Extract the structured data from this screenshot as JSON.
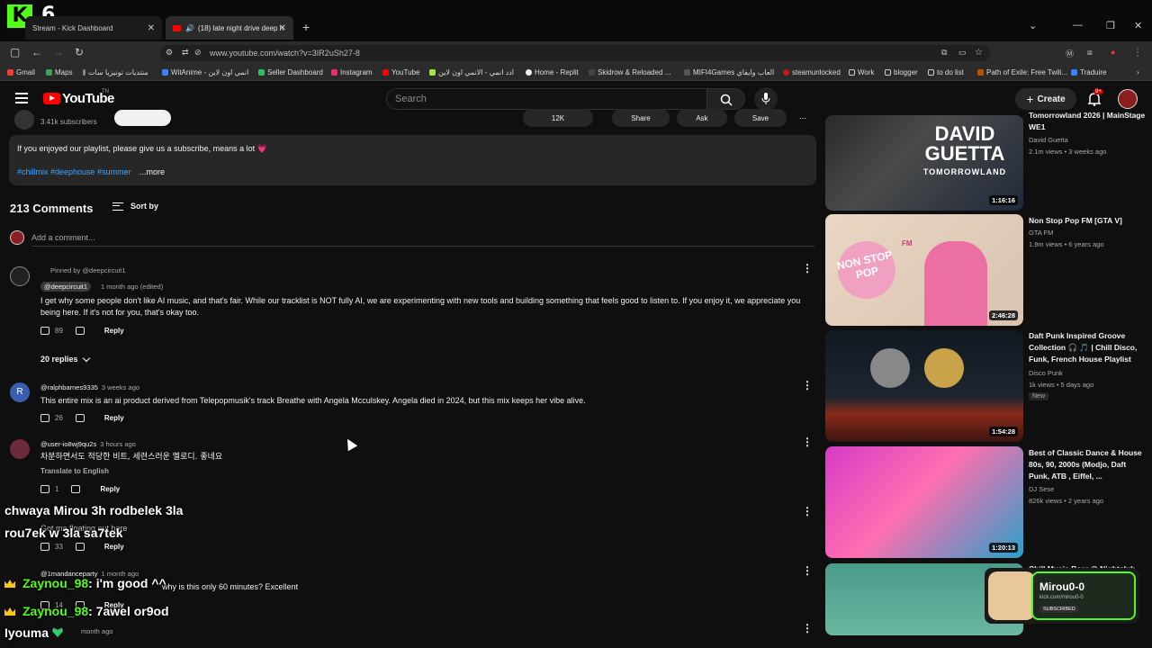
{
  "browser": {
    "tabs": [
      {
        "label": "Stream - Kick Dashboard"
      },
      {
        "label": "(18) late night drive deep h"
      }
    ],
    "url": "www.youtube.com/watch?v=3IR2uSh27-8",
    "bookmarks": [
      "Gmail",
      "Maps",
      "منتديات تونيزيا سات",
      "WitAnime - انمي اون لاين",
      "Seller Dashboard",
      "Instagram",
      "YouTube",
      "ادد انمي - الانمي اون لاين",
      "Home - Replit",
      "Skidrow & Reloaded ...",
      "MIFI4Games العاب وايفاي",
      "steamunlocked",
      "Work",
      "blogger",
      "to do list",
      "Path of Exile: Free Twili...",
      "Traduire"
    ]
  },
  "overlay": {
    "kick_logo": "K",
    "kick_number": "6",
    "chat": [
      {
        "user": "",
        "text": "chwaya Mirou 3h rodbelek 3la"
      },
      {
        "user": "",
        "text": "rou7ek w 3la sa7tek"
      },
      {
        "user": "Zaynou_98",
        "text": ": i'm good ^^"
      },
      {
        "user": "Zaynou_98",
        "text": ": 7awel or9od"
      },
      {
        "user": "Iyouma",
        "text": ""
      }
    ],
    "card": {
      "name": "Mirou0-0",
      "url": "kick.com/mirou0-0",
      "subscribed": "SUBSCRIBED"
    }
  },
  "header": {
    "logo_text": "YouTube",
    "logo_tn": "TN",
    "search_placeholder": "Search",
    "create_label": "Create",
    "notif_count": "9+"
  },
  "video": {
    "subscribers": "3.41k subscribers",
    "actions": [
      "12K",
      "",
      "Share",
      "Ask",
      "Save"
    ],
    "description": "If you enjoyed our playlist, please give us a subscribe, means a lot 💗",
    "hashtags": "#chillmix #deephouse #summer",
    "more": "...more"
  },
  "comments": {
    "count_label": "213 Comments",
    "sort_label": "Sort by",
    "add_placeholder": "Add a comment...",
    "items": [
      {
        "pinned": "Pinned by @deepcircuit1",
        "user": "@deepcircuit1",
        "time": "1 month ago (edited)",
        "text": "I get why some people don't like AI music, and that's fair. While our tracklist is NOT fully AI, we are experimenting with new tools and building something that feels good to listen to. If you enjoy it, we appreciate you being here. If it's not for you, that's okay too.",
        "likes": "89",
        "reply": "Reply",
        "replies": "20 replies"
      },
      {
        "user": "@ralphbarnes9335",
        "time": "3 weeks ago",
        "text": "This entire mix is an ai product derived from Telepopmusik's track Breathe with Angela Mcculskey. Angela died in 2024, but this mix keeps her vibe alive.",
        "likes": "26",
        "reply": "Reply"
      },
      {
        "user": "@user-io8wj9qu2s",
        "time": "3 hours ago",
        "text": "차분하면서도 적당한 비트, 세련스러운 멜로디. 좋네요",
        "translate": "Translate to English",
        "likes": "1",
        "reply": "Reply"
      },
      {
        "user": "",
        "time": "",
        "text": "Got me floating out here",
        "likes": "33",
        "reply": "Reply"
      },
      {
        "user": "@1mandanceparty",
        "time": "1 month ago",
        "text": "why is this only 60 minutes? Excellent",
        "likes": "14",
        "reply": "Reply"
      },
      {
        "user": "",
        "time": "month ago",
        "text": "",
        "likes": "",
        "reply": ""
      }
    ]
  },
  "sidebar": {
    "items": [
      {
        "title": "Tomorrowland 2026 | MainStage WE1",
        "channel": "David Guetta",
        "meta": "2.1m views • 3 weeks ago",
        "duration": "1:16:16",
        "thumb_text": "DAVID GUETTA",
        "thumb_sub": "TOMORROWLAND"
      },
      {
        "title": "Non Stop Pop FM [GTA V]",
        "channel": "GTA FM",
        "meta": "1.9m views • 6 years ago",
        "duration": "2:46:28",
        "thumb_text": "NON STOP POP",
        "thumb_sub": "FM"
      },
      {
        "title": "Daft Punk Inspired Groove Collection 🎧 🎵 | Chill Disco, Funk, French House Playlist",
        "channel": "Disco Punk",
        "meta": "1k views • 5 days ago",
        "badge": "New",
        "duration": "1:54:28"
      },
      {
        "title": "Best of Classic Dance & House 80s, 90, 2000s (Modjo, Daft Punk, ATB , Eiffel, ...",
        "channel": "DJ Sese",
        "meta": "826k views • 2 years ago",
        "duration": "1:20:13"
      },
      {
        "title": "Chill Music Bear @ Nightclub",
        "channel": "",
        "meta": "",
        "duration": ""
      }
    ]
  },
  "colors": {
    "accent": "#3ea6ff",
    "kick_green": "#53fc18",
    "yt_red": "#ff0000"
  }
}
